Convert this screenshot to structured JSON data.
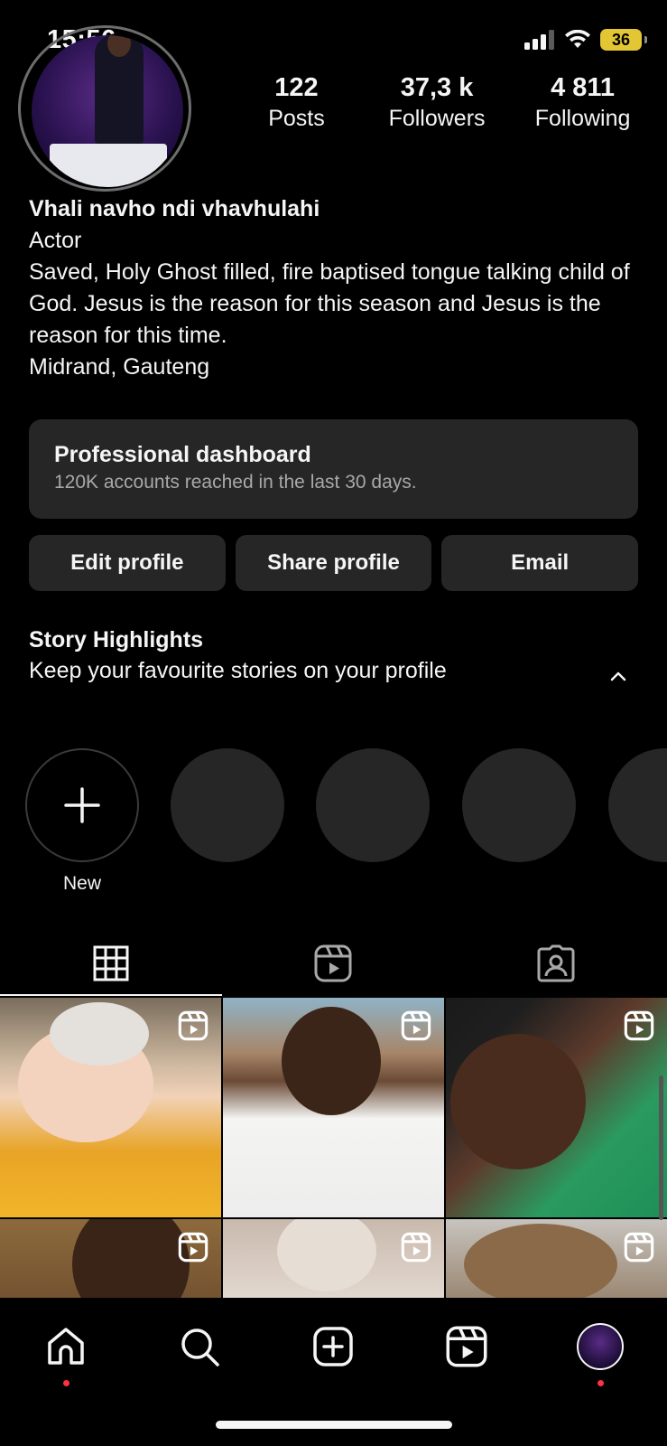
{
  "status_bar": {
    "time": "15:56",
    "battery": "36"
  },
  "profile": {
    "stats": [
      {
        "value": "122",
        "label": "Posts"
      },
      {
        "value": "37,3 k",
        "label": "Followers"
      },
      {
        "value": "4 811",
        "label": "Following"
      }
    ],
    "name": "Vhali navho ndi vhavhulahi",
    "category": "Actor",
    "bio": "Saved, Holy Ghost filled, fire baptised tongue talking child of God. Jesus is the reason for this season and Jesus is the reason for this time.",
    "location": "Midrand, Gauteng"
  },
  "dashboard": {
    "title": "Professional dashboard",
    "subtitle": "120K accounts reached in the last 30 days."
  },
  "actions": {
    "edit": "Edit profile",
    "share": "Share profile",
    "email": "Email"
  },
  "highlights": {
    "title": "Story Highlights",
    "subtitle": "Keep your favourite stories on your profile",
    "new_label": "New"
  },
  "tabs": [
    {
      "icon": "grid-icon"
    },
    {
      "icon": "reels-icon"
    },
    {
      "icon": "tagged-icon"
    }
  ],
  "nav": {
    "items": [
      "home-icon",
      "search-icon",
      "create-icon",
      "reels-icon",
      "profile-avatar"
    ]
  },
  "colors": {
    "background": "#000000",
    "surface": "#262626",
    "text": "#f5f5f5",
    "muted": "#a8a8a8",
    "notification": "#ff3040",
    "battery": "#e3c634"
  }
}
